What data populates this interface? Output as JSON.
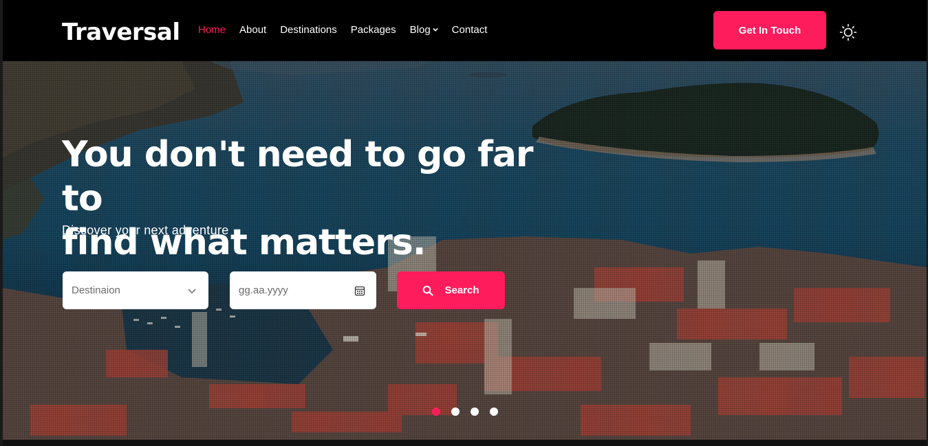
{
  "brand": {
    "logo": "Traversal",
    "accent": "#ff1c5c"
  },
  "nav": {
    "items": [
      {
        "label": "Home",
        "active": true
      },
      {
        "label": "About",
        "active": false
      },
      {
        "label": "Destinations",
        "active": false
      },
      {
        "label": "Packages",
        "active": false
      },
      {
        "label": "Blog",
        "active": false,
        "has_dropdown": true
      },
      {
        "label": "Contact",
        "active": false
      }
    ],
    "cta_label": "Get In Touch",
    "theme_icon": "sun-icon"
  },
  "hero": {
    "headline_line1": "You don't need to go far to",
    "headline_line2": "find what matters.",
    "subline": "Discover your next adventure",
    "destination_placeholder": "Destinaion",
    "date_placeholder": "gg.aa.yyyy",
    "search_label": "Search",
    "slides": {
      "count": 4,
      "active_index": 0
    }
  }
}
